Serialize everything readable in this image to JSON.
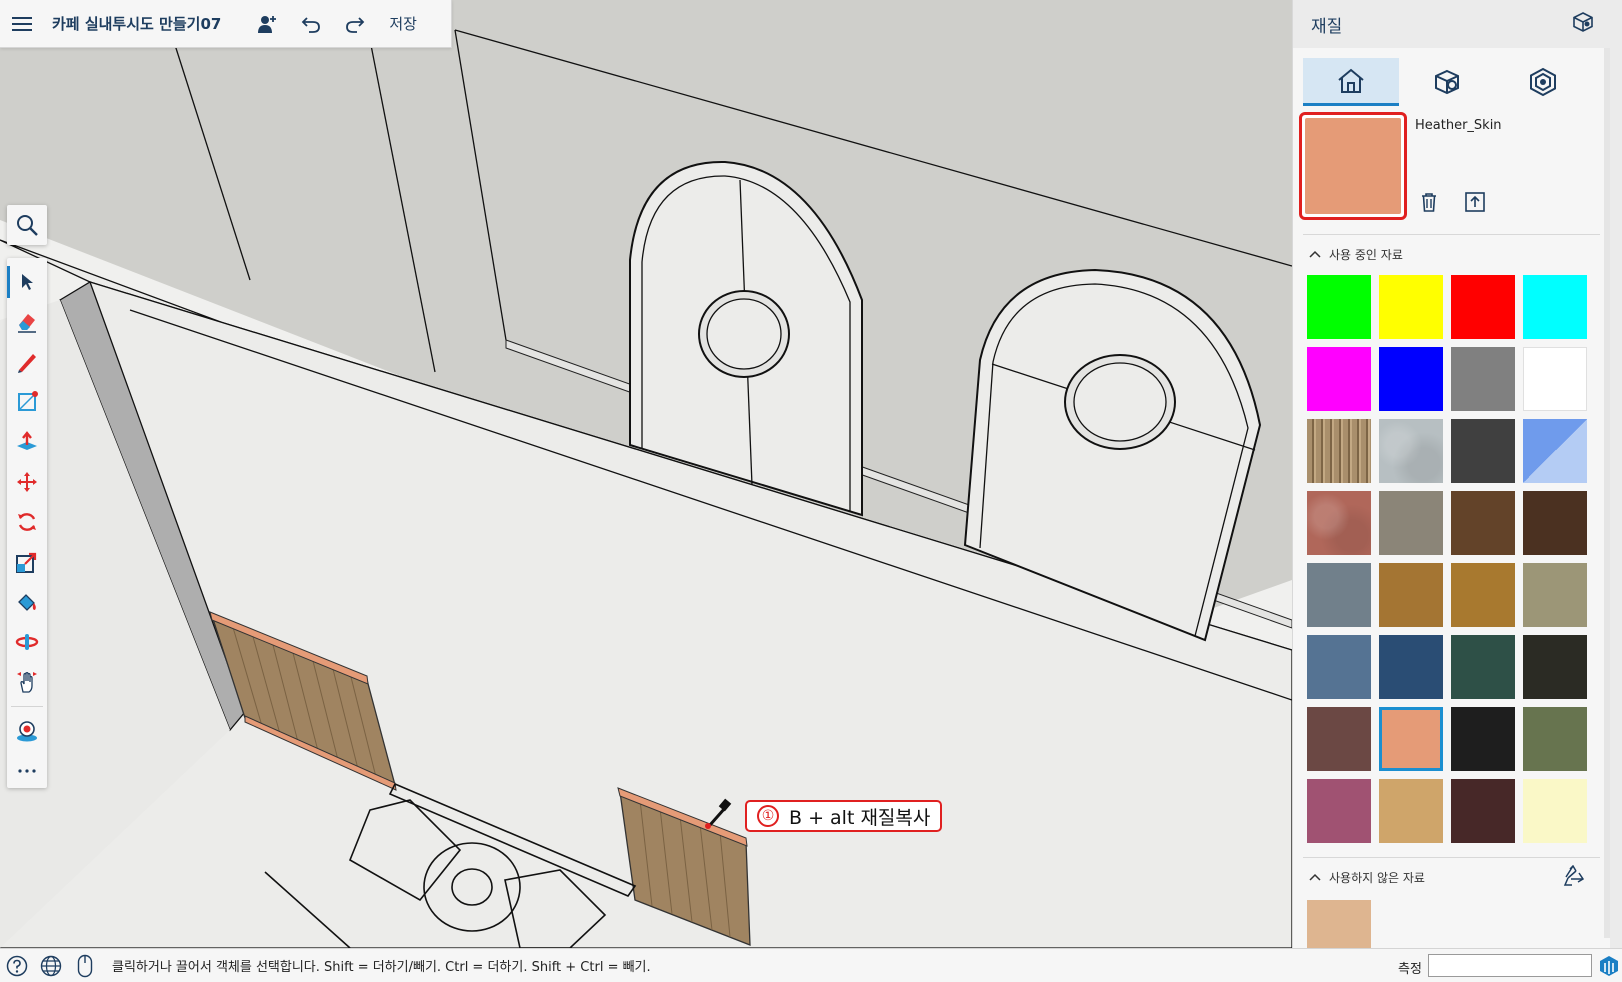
{
  "app": {
    "menu_icon": "hamburger-menu-icon",
    "title": "카페 실내투시도 만들기07",
    "save_label": "저장"
  },
  "toolbar_icons": [
    "hamburger-menu-icon",
    "add-user-icon",
    "undo-icon",
    "redo-icon"
  ],
  "tools": [
    "search-icon",
    "select-arrow-icon",
    "eraser-icon",
    "pencil-line-icon",
    "rectangle-icon",
    "push-pull-icon",
    "move-icon",
    "rotate-icon",
    "scale-icon",
    "paint-bucket-icon",
    "orbit-icon",
    "pan-icon",
    "position-camera-icon",
    "more-icon"
  ],
  "active_tool": "select",
  "callout": {
    "number": "①",
    "text": "B + alt 재질복사"
  },
  "panel": {
    "title": "재질",
    "tabs": [
      "home-icon",
      "material-edit-icon",
      "material-library-icon"
    ],
    "current_material": {
      "name": "Heather_Skin",
      "color": "#e59b77"
    },
    "used_section_title": "사용 중인 자료",
    "unused_section_title": "사용하지 않은 자료",
    "used_materials": [
      {
        "color": "#00ff00",
        "pattern": "solid"
      },
      {
        "color": "#ffff00",
        "pattern": "solid"
      },
      {
        "color": "#ff0000",
        "pattern": "solid"
      },
      {
        "color": "#00ffff",
        "pattern": "solid"
      },
      {
        "color": "#ff00ff",
        "pattern": "solid"
      },
      {
        "color": "#0000ff",
        "pattern": "solid"
      },
      {
        "color": "#808080",
        "pattern": "solid"
      },
      {
        "color": "#ffffff",
        "pattern": "solid"
      },
      {
        "color": "#a98f6c",
        "pattern": "wood-slats"
      },
      {
        "color": "#b7bfc2",
        "pattern": "noise"
      },
      {
        "color": "#404040",
        "pattern": "solid"
      },
      {
        "color": "#6f9bec",
        "pattern": "diagonal"
      },
      {
        "color": "#b0675a",
        "pattern": "noise"
      },
      {
        "color": "#8b8578",
        "pattern": "solid"
      },
      {
        "color": "#634329",
        "pattern": "solid"
      },
      {
        "color": "#4b3121",
        "pattern": "solid"
      },
      {
        "color": "#71808b",
        "pattern": "solid"
      },
      {
        "color": "#a47533",
        "pattern": "solid"
      },
      {
        "color": "#a8792f",
        "pattern": "solid"
      },
      {
        "color": "#9c9677",
        "pattern": "solid"
      },
      {
        "color": "#557393",
        "pattern": "solid"
      },
      {
        "color": "#2a4d74",
        "pattern": "solid"
      },
      {
        "color": "#2e5047",
        "pattern": "solid"
      },
      {
        "color": "#2b2b24",
        "pattern": "solid"
      },
      {
        "color": "#6b4844",
        "pattern": "solid"
      },
      {
        "color": "#e59b77",
        "pattern": "solid",
        "selected": true
      },
      {
        "color": "#1e1e1e",
        "pattern": "solid"
      },
      {
        "color": "#67744f",
        "pattern": "solid"
      },
      {
        "color": "#a05272",
        "pattern": "solid"
      },
      {
        "color": "#cfa56a",
        "pattern": "solid"
      },
      {
        "color": "#472828",
        "pattern": "solid"
      },
      {
        "color": "#faf8c7",
        "pattern": "solid"
      }
    ],
    "unused_materials": [
      {
        "color": "#deb590",
        "pattern": "solid"
      }
    ]
  },
  "status": {
    "text": "클릭하거나 끌어서 객체를 선택합니다. Shift = 더하기/빼기. Ctrl = 더하기. Shift + Ctrl = 빼기.",
    "measure_label": "측정",
    "measure_value": "",
    "icons": [
      "help-icon",
      "globe-icon",
      "mouse-icon",
      "sketchup-logo-icon"
    ]
  }
}
